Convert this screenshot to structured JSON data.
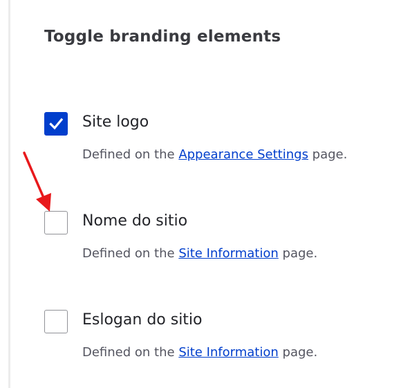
{
  "section": {
    "title": "Toggle branding elements"
  },
  "options": [
    {
      "label": "Site logo",
      "checked": true,
      "desc_prefix": "Defined on the ",
      "desc_link": "Appearance Settings",
      "desc_suffix": " page."
    },
    {
      "label": "Nome do sitio",
      "checked": false,
      "desc_prefix": "Defined on the ",
      "desc_link": "Site Information",
      "desc_suffix": " page."
    },
    {
      "label": "Eslogan do sitio",
      "checked": false,
      "desc_prefix": "Defined on the ",
      "desc_link": "Site Information",
      "desc_suffix": " page."
    }
  ],
  "colors": {
    "accent": "#003ecc",
    "annotation_arrow": "#e8191c"
  },
  "icons": {
    "checkmark": "checkmark-icon",
    "arrow": "red-arrow-annotation-icon"
  }
}
